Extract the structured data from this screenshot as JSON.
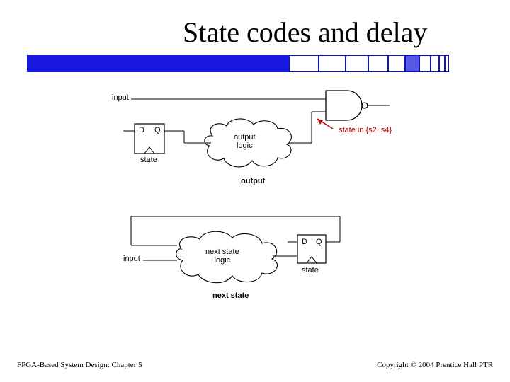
{
  "title": "State codes and delay",
  "bar": {
    "solid_color": "#1818e0",
    "box_count": 10
  },
  "diagram": {
    "top": {
      "input_label": "input",
      "ff": {
        "d": "D",
        "q": "Q"
      },
      "ff_caption": "state",
      "cloud_label": "output\nlogic",
      "output_caption": "output",
      "state_annotation": "state in {s2, s4}"
    },
    "bottom": {
      "input_label": "input",
      "cloud_label": "next state\nlogic",
      "ff": {
        "d": "D",
        "q": "Q"
      },
      "ff_caption": "state",
      "caption": "next state"
    }
  },
  "footer_left": "FPGA-Based System Design: Chapter 5",
  "footer_right": "Copyright © 2004 Prentice Hall PTR"
}
